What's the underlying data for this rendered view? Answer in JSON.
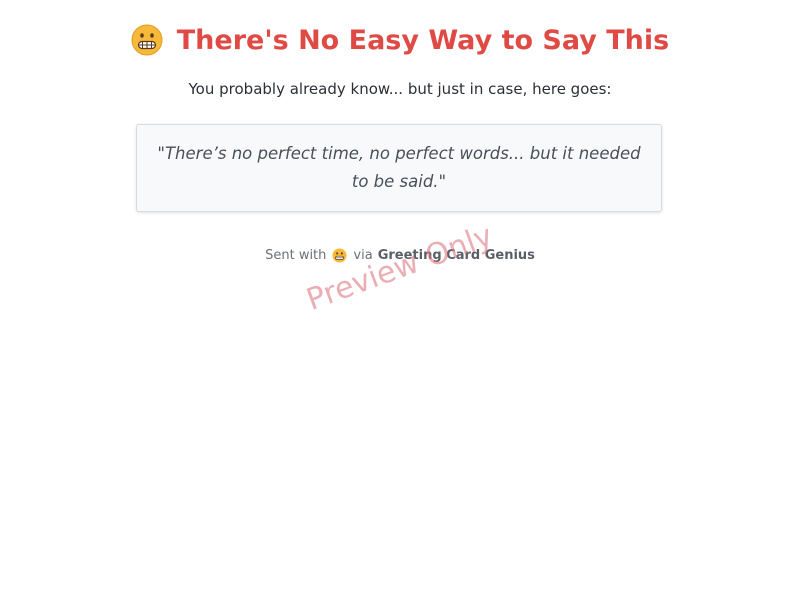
{
  "card": {
    "title": "There's No Easy Way to Say This",
    "title_icon": "grimacing-face-icon",
    "subtitle": "You probably already know... but just in case, here goes:",
    "quote": "\"There’s no perfect time, no perfect words... but it needed to be said.\""
  },
  "footer": {
    "prefix": "Sent with",
    "icon": "grimacing-face-icon",
    "via": "via",
    "brand": "Greeting Card Genius"
  },
  "watermark": "Preview Only",
  "colors": {
    "title": "#e04a45",
    "watermark": "#dc7882",
    "quote_bg": "#f7f9fb",
    "emoji_face": "#f7b93a"
  }
}
